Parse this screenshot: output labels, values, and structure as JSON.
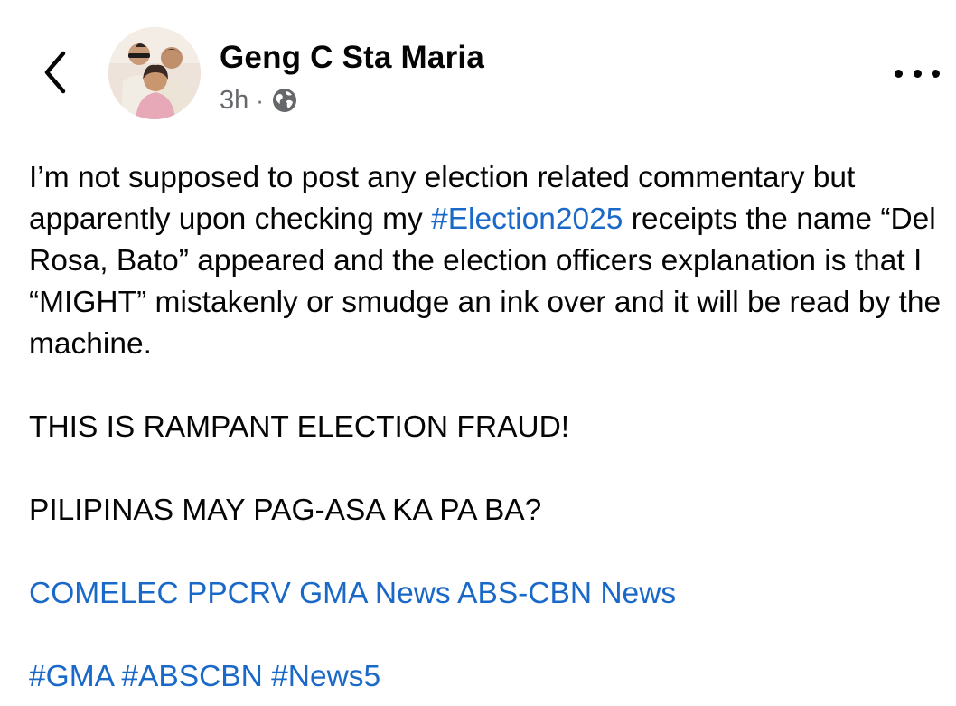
{
  "post": {
    "author": "Geng C Sta Maria",
    "time": "3h",
    "separator": "·",
    "privacy_icon": "globe-icon",
    "back_icon": "chevron-left-icon",
    "more_icon": "more-horizontal-icon",
    "avatar_icon": "profile-photo",
    "body": {
      "p1_before": "I’m not supposed to post any election related commentary but apparently upon checking my ",
      "p1_hashtag": "#Election2025",
      "p1_after": " receipts the name “Del Rosa, Bato” appeared and the election officers explanation is that I “MIGHT” mistakenly or smudge an ink over and it will be read by the machine.",
      "p2": "THIS IS RAMPANT ELECTION FRAUD!",
      "p3": "PILIPINAS MAY PAG-ASA KA PA BA?",
      "mentions": [
        "COMELEC",
        "PPCRV",
        "GMA News",
        "ABS-CBN News"
      ],
      "hashtags": [
        "#GMA",
        "#ABSCBN",
        "#News5"
      ]
    }
  },
  "colors": {
    "text": "#050505",
    "meta": "#65676b",
    "link": "#1a68c7",
    "background": "#ffffff"
  }
}
